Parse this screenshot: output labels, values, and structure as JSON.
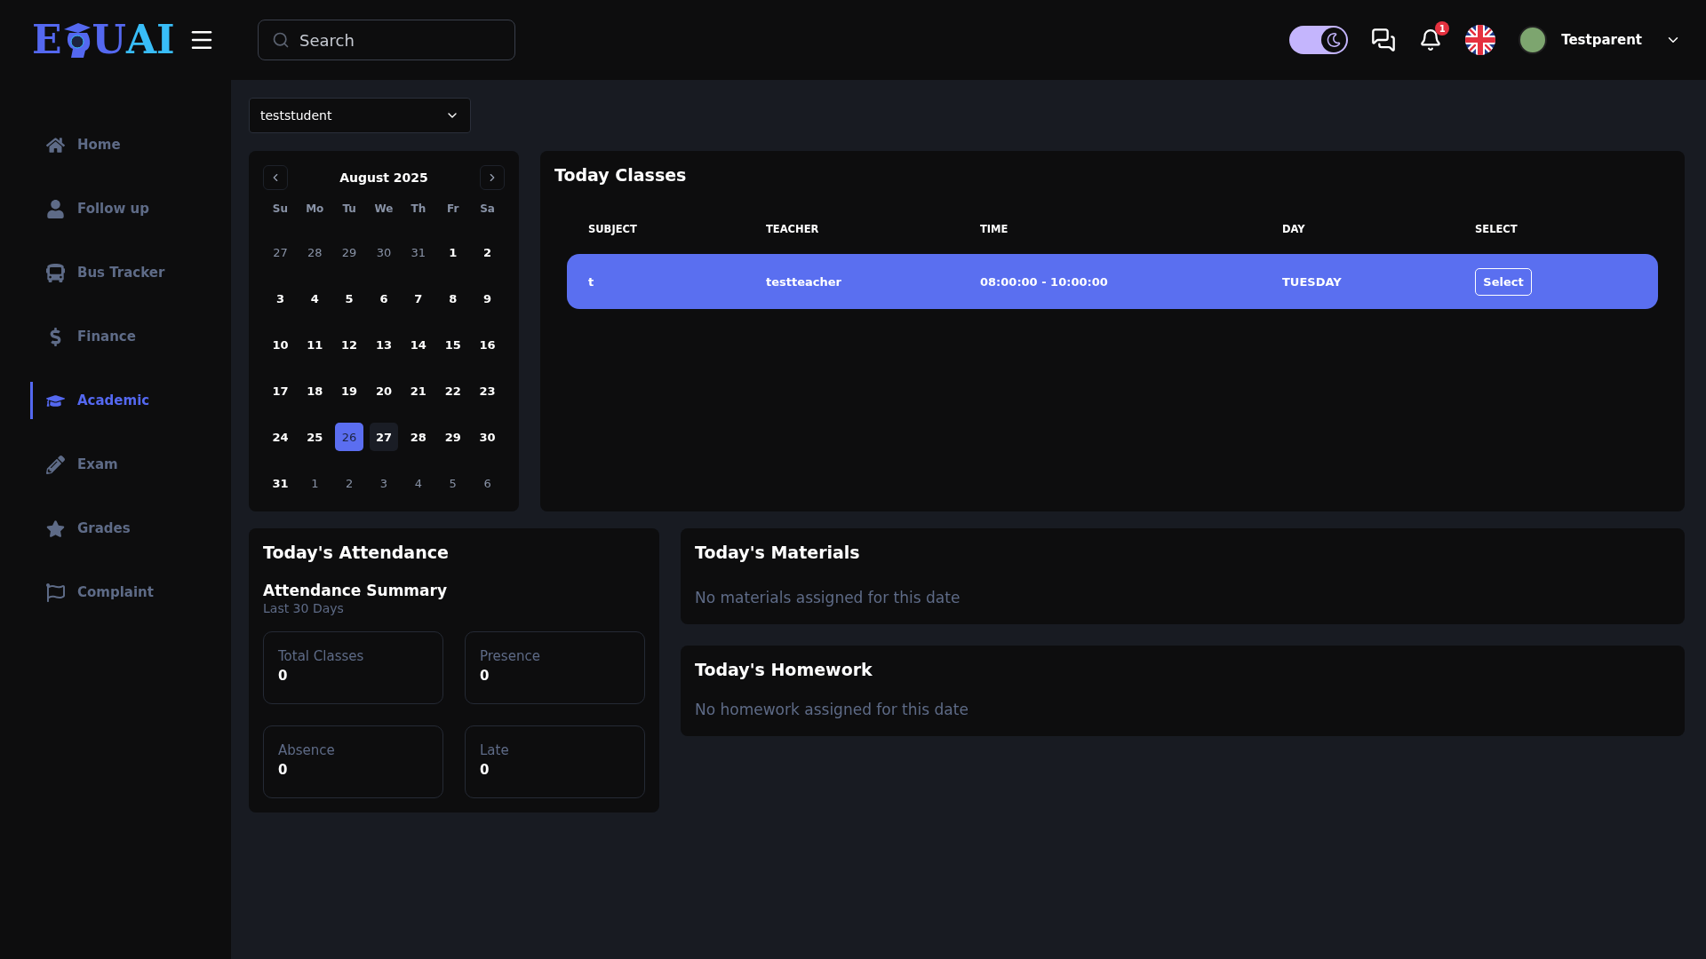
{
  "logo": {
    "parts": [
      {
        "text": "E",
        "color": "#5468f0"
      },
      {
        "text": "U",
        "color": "#5468f0"
      },
      {
        "text": "AI",
        "color": "#38bdf8"
      }
    ]
  },
  "search": {
    "placeholder": "Search"
  },
  "header": {
    "dark_mode": true,
    "notifications": "1",
    "user": "Testparent"
  },
  "sidebar": {
    "items": [
      {
        "label": "Home",
        "selected": false
      },
      {
        "label": "Follow up",
        "selected": false
      },
      {
        "label": "Bus Tracker",
        "selected": false
      },
      {
        "label": "Finance",
        "selected": false
      },
      {
        "label": "Academic",
        "selected": true
      },
      {
        "label": "Exam",
        "selected": false
      },
      {
        "label": "Grades",
        "selected": false
      },
      {
        "label": "Complaint",
        "selected": false
      }
    ]
  },
  "student_select": {
    "value": "teststudent"
  },
  "calendar": {
    "title": "August 2025",
    "weekdays": [
      "Su",
      "Mo",
      "Tu",
      "We",
      "Th",
      "Fr",
      "Sa"
    ],
    "days": [
      {
        "d": "27",
        "outside": true,
        "selected": false,
        "today": false
      },
      {
        "d": "28",
        "outside": true,
        "selected": false,
        "today": false
      },
      {
        "d": "29",
        "outside": true,
        "selected": false,
        "today": false
      },
      {
        "d": "30",
        "outside": true,
        "selected": false,
        "today": false
      },
      {
        "d": "31",
        "outside": true,
        "selected": false,
        "today": false
      },
      {
        "d": "1",
        "outside": false,
        "selected": false,
        "today": false
      },
      {
        "d": "2",
        "outside": false,
        "selected": false,
        "today": false
      },
      {
        "d": "3",
        "outside": false,
        "selected": false,
        "today": false
      },
      {
        "d": "4",
        "outside": false,
        "selected": false,
        "today": false
      },
      {
        "d": "5",
        "outside": false,
        "selected": false,
        "today": false
      },
      {
        "d": "6",
        "outside": false,
        "selected": false,
        "today": false
      },
      {
        "d": "7",
        "outside": false,
        "selected": false,
        "today": false
      },
      {
        "d": "8",
        "outside": false,
        "selected": false,
        "today": false
      },
      {
        "d": "9",
        "outside": false,
        "selected": false,
        "today": false
      },
      {
        "d": "10",
        "outside": false,
        "selected": false,
        "today": false
      },
      {
        "d": "11",
        "outside": false,
        "selected": false,
        "today": false
      },
      {
        "d": "12",
        "outside": false,
        "selected": false,
        "today": false
      },
      {
        "d": "13",
        "outside": false,
        "selected": false,
        "today": false
      },
      {
        "d": "14",
        "outside": false,
        "selected": false,
        "today": false
      },
      {
        "d": "15",
        "outside": false,
        "selected": false,
        "today": false
      },
      {
        "d": "16",
        "outside": false,
        "selected": false,
        "today": false
      },
      {
        "d": "17",
        "outside": false,
        "selected": false,
        "today": false
      },
      {
        "d": "18",
        "outside": false,
        "selected": false,
        "today": false
      },
      {
        "d": "19",
        "outside": false,
        "selected": false,
        "today": false
      },
      {
        "d": "20",
        "outside": false,
        "selected": false,
        "today": false
      },
      {
        "d": "21",
        "outside": false,
        "selected": false,
        "today": false
      },
      {
        "d": "22",
        "outside": false,
        "selected": false,
        "today": false
      },
      {
        "d": "23",
        "outside": false,
        "selected": false,
        "today": false
      },
      {
        "d": "24",
        "outside": false,
        "selected": false,
        "today": false
      },
      {
        "d": "25",
        "outside": false,
        "selected": false,
        "today": false
      },
      {
        "d": "26",
        "outside": false,
        "selected": true,
        "today": false
      },
      {
        "d": "27",
        "outside": false,
        "selected": false,
        "today": true
      },
      {
        "d": "28",
        "outside": false,
        "selected": false,
        "today": false
      },
      {
        "d": "29",
        "outside": false,
        "selected": false,
        "today": false
      },
      {
        "d": "30",
        "outside": false,
        "selected": false,
        "today": false
      },
      {
        "d": "31",
        "outside": false,
        "selected": false,
        "today": false
      },
      {
        "d": "1",
        "outside": true,
        "selected": false,
        "today": false
      },
      {
        "d": "2",
        "outside": true,
        "selected": false,
        "today": false
      },
      {
        "d": "3",
        "outside": true,
        "selected": false,
        "today": false
      },
      {
        "d": "4",
        "outside": true,
        "selected": false,
        "today": false
      },
      {
        "d": "5",
        "outside": true,
        "selected": false,
        "today": false
      },
      {
        "d": "6",
        "outside": true,
        "selected": false,
        "today": false
      }
    ]
  },
  "today_classes": {
    "title": "Today Classes",
    "columns": [
      "SUBJECT",
      "TEACHER",
      "TIME",
      "DAY",
      "SELECT"
    ],
    "rows": [
      {
        "subject": "t",
        "teacher": "testteacher",
        "time": "08:00:00 - 10:00:00",
        "day": "TUESDAY",
        "button": "Select",
        "selected": true
      }
    ]
  },
  "attendance": {
    "title": "Today's Attendance",
    "subtitle": "Attendance Summary",
    "period": "Last 30 Days",
    "stats": [
      {
        "label": "Total Classes",
        "value": "0"
      },
      {
        "label": "Presence",
        "value": "0"
      },
      {
        "label": "Absence",
        "value": "0"
      },
      {
        "label": "Late",
        "value": "0"
      }
    ]
  },
  "materials": {
    "title": "Today's Materials",
    "message": "No materials assigned for this date"
  },
  "homework": {
    "title": "Today's Homework",
    "message": "No homework assigned for this date"
  }
}
